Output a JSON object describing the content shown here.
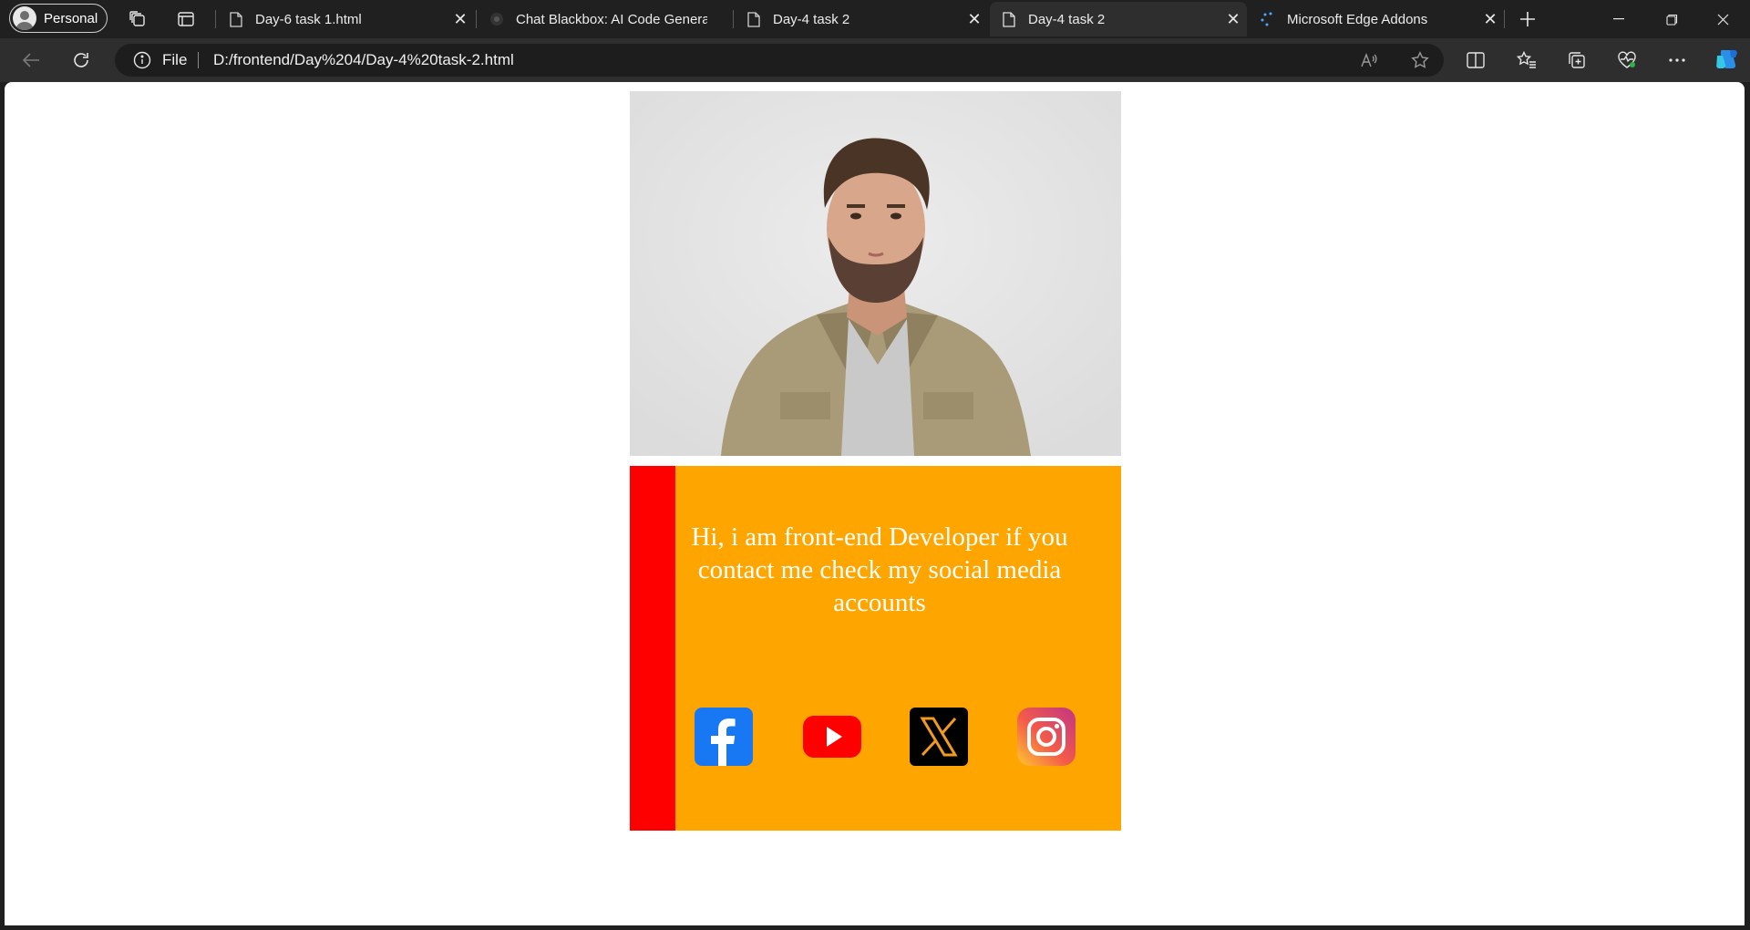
{
  "browser": {
    "profile_label": "Personal",
    "tabs": [
      {
        "title": "Day-6 task 1.html",
        "favicon": "page-icon",
        "active": false
      },
      {
        "title": "Chat Blackbox: AI Code Generation",
        "favicon": "blackbox-icon",
        "active": false
      },
      {
        "title": "Day-4 task 2",
        "favicon": "page-icon",
        "active": false
      },
      {
        "title": "Day-4 task 2",
        "favicon": "page-icon",
        "active": true
      },
      {
        "title": "Microsoft Edge Addons",
        "favicon": "edge-addons-icon",
        "active": false
      }
    ],
    "address": {
      "scheme_label": "File",
      "url": "D:/frontend/Day%204/Day-4%20task-2.html"
    }
  },
  "page": {
    "photo_alt": "profile-photo",
    "card": {
      "message": "Hi, i am front-end Developer if you contact me check my social media accounts",
      "stripe_color": "#ff0000",
      "background_color": "#ffa500"
    },
    "social_links": [
      {
        "name": "facebook-icon",
        "color": "#1877f2"
      },
      {
        "name": "youtube-icon",
        "color": "#ff0000"
      },
      {
        "name": "x-icon",
        "color": "#000000"
      },
      {
        "name": "instagram-icon",
        "color": "#e1306c"
      }
    ]
  }
}
